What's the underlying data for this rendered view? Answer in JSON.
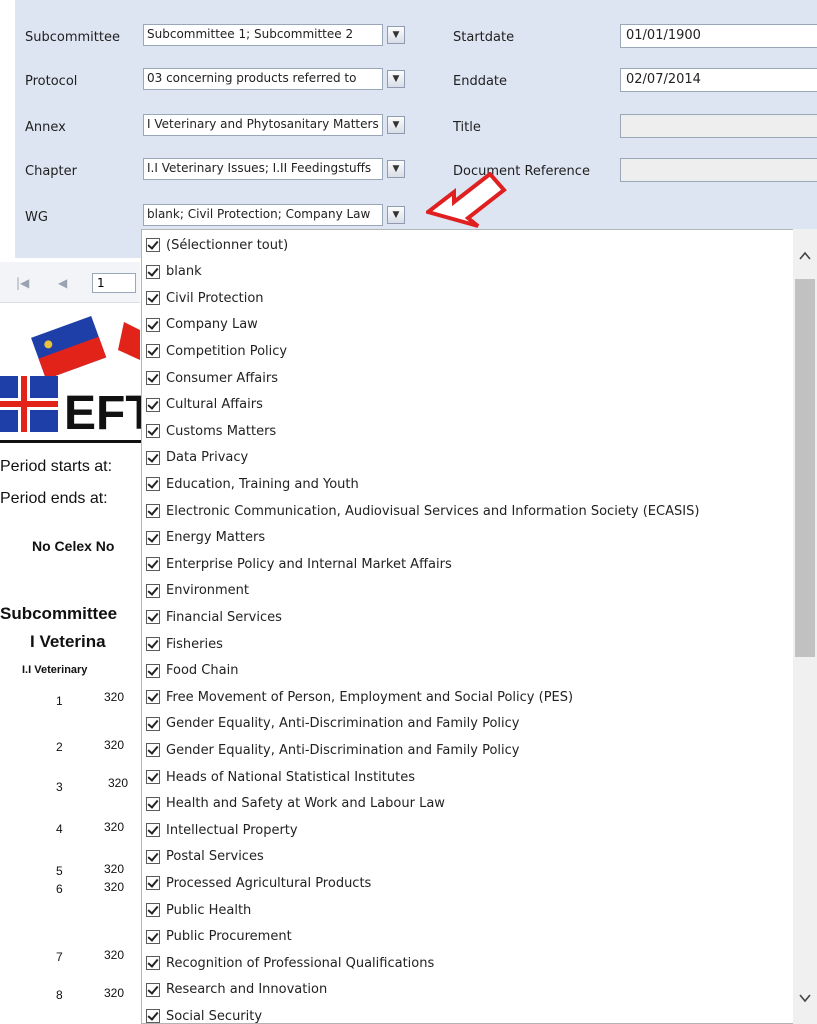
{
  "params": {
    "subcommittee": {
      "label": "Subcommittee",
      "value": "Subcommittee 1; Subcommittee 2"
    },
    "protocol": {
      "label": "Protocol",
      "value": "03 concerning products referred to"
    },
    "annex": {
      "label": "Annex",
      "value": "I Veterinary and Phytosanitary Matters"
    },
    "chapter": {
      "label": "Chapter",
      "value": "I.I Veterinary Issues; I.II Feedingstuffs"
    },
    "wg": {
      "label": "WG",
      "value": "blank; Civil Protection; Company Law"
    },
    "startdate": {
      "label": "Startdate",
      "value": "01/01/1900"
    },
    "enddate": {
      "label": "Enddate",
      "value": "02/07/2014"
    },
    "title": {
      "label": "Title",
      "value": ""
    },
    "docref": {
      "label": "Document Reference",
      "value": ""
    }
  },
  "toolbar": {
    "page": "1"
  },
  "report": {
    "logo_text": "EFT",
    "period_start": "Period starts at:",
    "period_end": "Period ends at:",
    "col_header": "No  Celex No",
    "group": "Subcommittee",
    "annex": "I Veterina",
    "chapter": "I.I Veterinary",
    "rows": [
      {
        "no": "1",
        "celex": "320"
      },
      {
        "no": "2",
        "celex": "320"
      },
      {
        "no": "3",
        "celex": "320"
      },
      {
        "no": "4",
        "celex": "320"
      },
      {
        "no": "5",
        "celex": "320"
      },
      {
        "no": "6",
        "celex": "320"
      },
      {
        "no": "7",
        "celex": "320"
      },
      {
        "no": "8",
        "celex": "320"
      }
    ]
  },
  "dropdown_items": [
    "(Sélectionner tout)",
    "blank",
    "Civil Protection",
    "Company Law",
    "Competition Policy",
    "Consumer Affairs",
    "Cultural Affairs",
    "Customs Matters",
    "Data Privacy",
    "Education, Training and Youth",
    "Electronic Communication, Audiovisual Services and Information Society (ECASIS)",
    "Energy Matters",
    "Enterprise Policy and Internal Market Affairs",
    "Environment",
    "Financial Services",
    "Fisheries",
    "Food Chain",
    "Free Movement of Person, Employment and Social Policy (PES)",
    "Gender Equality,  Anti-Discrimination and Family Policy",
    "Gender Equality, Anti-Discrimination and Family Policy",
    "Heads of National Statistical Institutes",
    "Health and Safety at Work and Labour Law",
    "Intellectual Property",
    "Postal Services",
    "Processed Agricultural Products",
    "Public Health",
    "Public Procurement",
    "Recognition of Professional Qualifications",
    "Research and Innovation",
    "Social Security"
  ],
  "colors": {
    "param_bg": "#dde5f2",
    "arrow": "#e02020",
    "scroll_thumb": "#c1c1c1"
  }
}
